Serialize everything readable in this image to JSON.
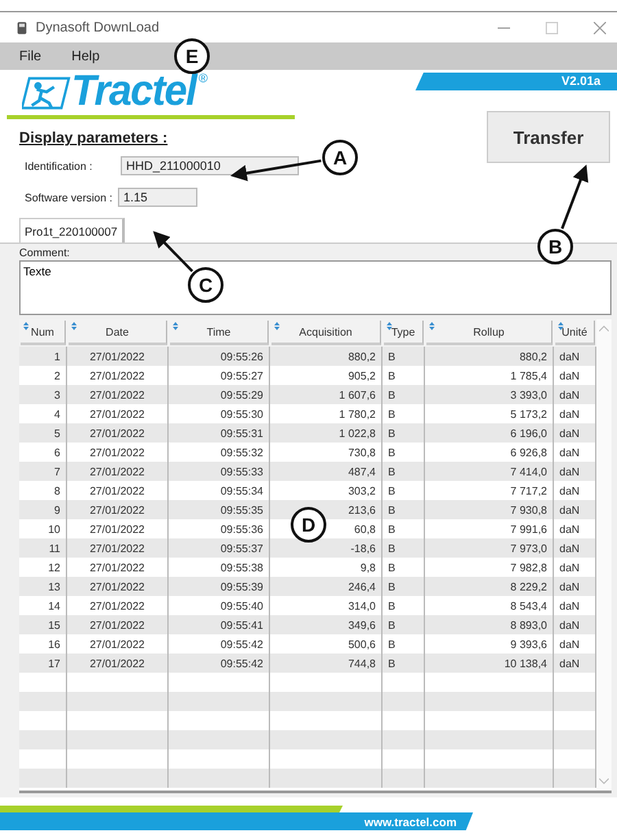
{
  "window": {
    "title": "Dynasoft DownLoad"
  },
  "menu": [
    "File",
    "Help"
  ],
  "logo": {
    "text": "Tractel",
    "mark": "®"
  },
  "version": "V2.01a",
  "display_parameters": {
    "heading": "Display parameters :",
    "fields": [
      {
        "label": "Identification :",
        "value": "HHD_211000010"
      },
      {
        "label": "Software version :",
        "value": "1.15"
      }
    ]
  },
  "transfer_button": "Transfer",
  "tabs": [
    {
      "label": "Pro1t_220100007",
      "selected": true
    }
  ],
  "comment": {
    "label": "Comment:",
    "value": "Texte"
  },
  "table": {
    "columns": [
      "Num",
      "Date",
      "Time",
      "Acquisition",
      "Type",
      "Rollup",
      "Unité"
    ],
    "rows": [
      [
        "1",
        "27/01/2022",
        "09:55:26",
        "880,2",
        "B",
        "880,2",
        "daN"
      ],
      [
        "2",
        "27/01/2022",
        "09:55:27",
        "905,2",
        "B",
        "1 785,4",
        "daN"
      ],
      [
        "3",
        "27/01/2022",
        "09:55:29",
        "1 607,6",
        "B",
        "3 393,0",
        "daN"
      ],
      [
        "4",
        "27/01/2022",
        "09:55:30",
        "1 780,2",
        "B",
        "5 173,2",
        "daN"
      ],
      [
        "5",
        "27/01/2022",
        "09:55:31",
        "1 022,8",
        "B",
        "6 196,0",
        "daN"
      ],
      [
        "6",
        "27/01/2022",
        "09:55:32",
        "730,8",
        "B",
        "6 926,8",
        "daN"
      ],
      [
        "7",
        "27/01/2022",
        "09:55:33",
        "487,4",
        "B",
        "7 414,0",
        "daN"
      ],
      [
        "8",
        "27/01/2022",
        "09:55:34",
        "303,2",
        "B",
        "7 717,2",
        "daN"
      ],
      [
        "9",
        "27/01/2022",
        "09:55:35",
        "213,6",
        "B",
        "7 930,8",
        "daN"
      ],
      [
        "10",
        "27/01/2022",
        "09:55:36",
        "60,8",
        "B",
        "7 991,6",
        "daN"
      ],
      [
        "11",
        "27/01/2022",
        "09:55:37",
        "-18,6",
        "B",
        "7 973,0",
        "daN"
      ],
      [
        "12",
        "27/01/2022",
        "09:55:38",
        "9,8",
        "B",
        "7 982,8",
        "daN"
      ],
      [
        "13",
        "27/01/2022",
        "09:55:39",
        "246,4",
        "B",
        "8 229,2",
        "daN"
      ],
      [
        "14",
        "27/01/2022",
        "09:55:40",
        "314,0",
        "B",
        "8 543,4",
        "daN"
      ],
      [
        "15",
        "27/01/2022",
        "09:55:41",
        "349,6",
        "B",
        "8 893,0",
        "daN"
      ],
      [
        "16",
        "27/01/2022",
        "09:55:42",
        "500,6",
        "B",
        "9 393,6",
        "daN"
      ],
      [
        "17",
        "27/01/2022",
        "09:55:42",
        "744,8",
        "B",
        "10 138,4",
        "daN"
      ]
    ]
  },
  "footer": {
    "url": "www.tractel.com"
  },
  "callouts": [
    {
      "letter": "E"
    },
    {
      "letter": "A"
    },
    {
      "letter": "B"
    },
    {
      "letter": "C"
    },
    {
      "letter": "D"
    }
  ]
}
